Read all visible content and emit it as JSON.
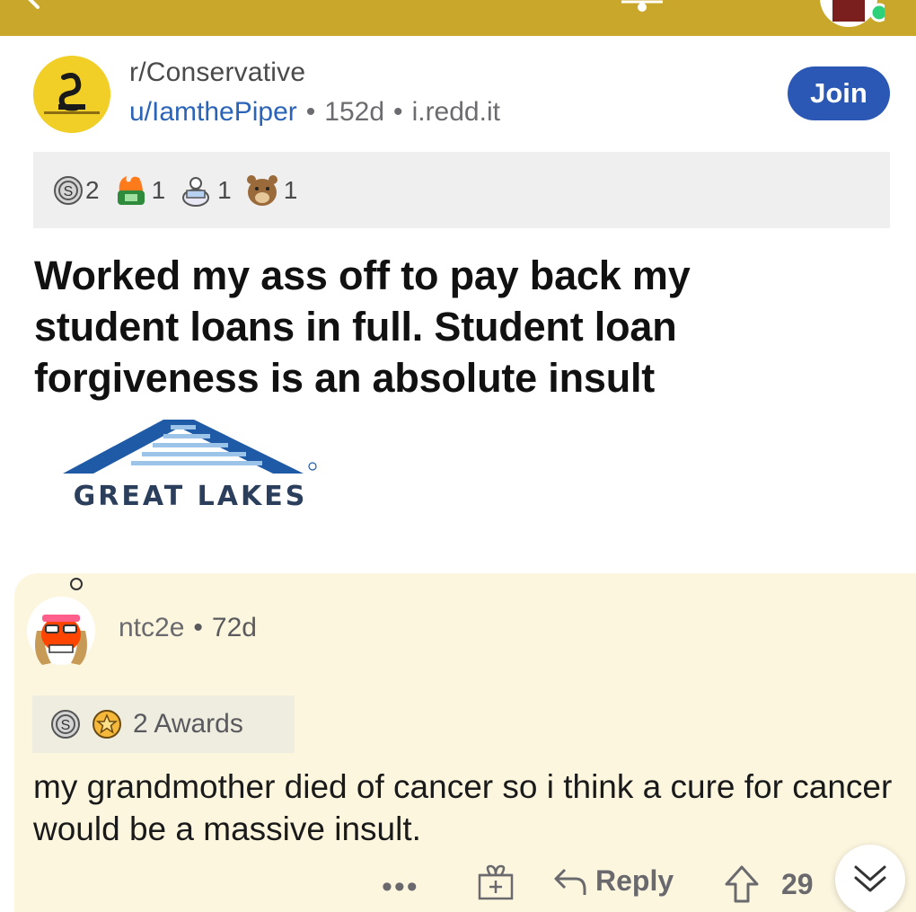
{
  "colors": {
    "topbar": "#c9a72b",
    "join_button": "#2b58b5",
    "username_link": "#2a63b8",
    "comment_background": "#fcf6df"
  },
  "post": {
    "subreddit": "r/Conservative",
    "author": "u/IamthePiper",
    "age": "152d",
    "source": "i.redd.it",
    "join_label": "Join",
    "awards": [
      {
        "icon": "silver-award-icon",
        "count": "2"
      },
      {
        "icon": "money-fire-award-icon",
        "count": "1"
      },
      {
        "icon": "wholesome-seal-award-icon",
        "count": "1"
      },
      {
        "icon": "bear-award-icon",
        "count": "1"
      }
    ],
    "title": "Worked my ass off to pay back my student loans in full. Student loan forgiveness is an absolute insult",
    "image": {
      "logo_text": "GREAT LAKES"
    }
  },
  "comment": {
    "author": "ntc2e",
    "age": "72d",
    "awards_label": "2 Awards",
    "award_icons": [
      "silver-award-icon",
      "helpful-award-icon"
    ],
    "body": "my grandmother died of cancer so i think a cure for cancer would be a massive insult.",
    "more_label": "•••",
    "reply_label": "Reply",
    "votes": "29"
  }
}
